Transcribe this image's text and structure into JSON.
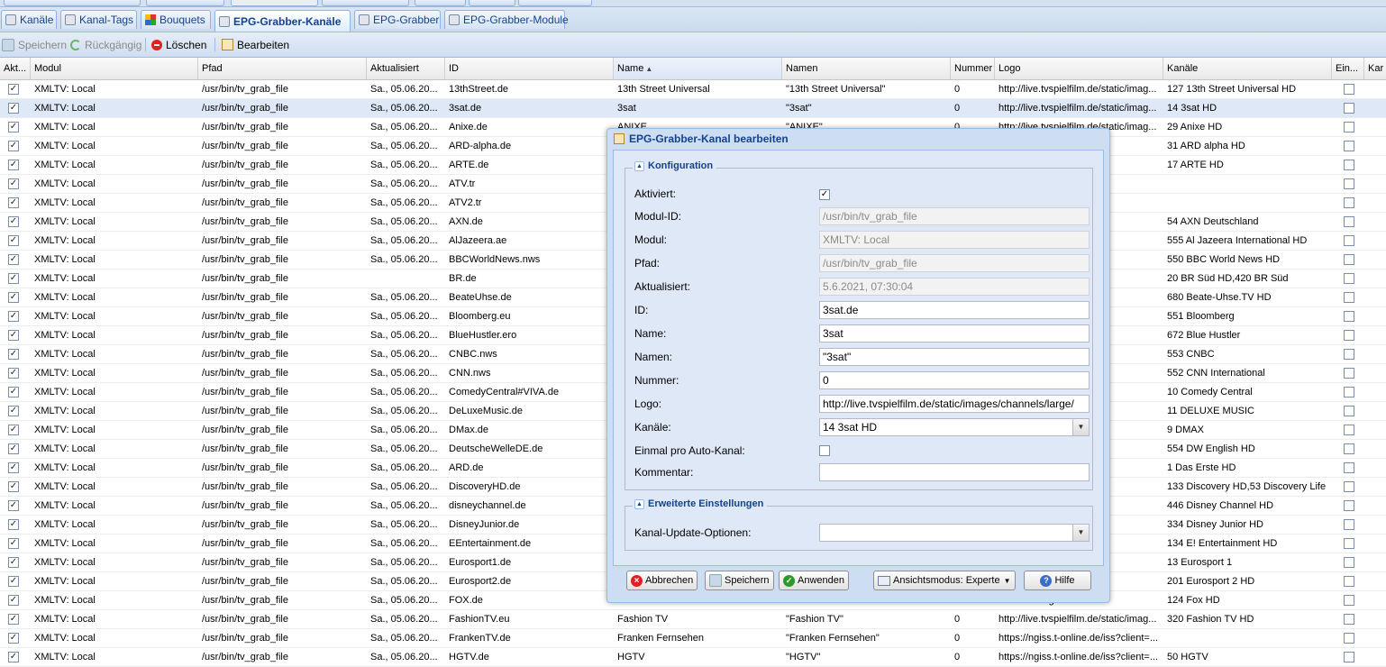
{
  "tabs": [
    {
      "label": "Kanäle",
      "icon": "channel-icon"
    },
    {
      "label": "Kanal-Tags",
      "icon": "tag-icon"
    },
    {
      "label": "Bouquets",
      "icon": "bouquet-icon"
    },
    {
      "label": "EPG-Grabber-Kanäle",
      "icon": "epg-grabber-channels-icon"
    },
    {
      "label": "EPG-Grabber",
      "icon": "epg-grabber-icon"
    },
    {
      "label": "EPG-Grabber-Module",
      "icon": "epg-grabber-modules-icon"
    }
  ],
  "toolbar": {
    "save": "Speichern",
    "undo": "Rückgängig",
    "delete": "Löschen",
    "edit": "Bearbeiten"
  },
  "columns": [
    "Akt...",
    "Modul",
    "Pfad",
    "Aktualisiert",
    "ID",
    "Name",
    "Namen",
    "Nummer",
    "Logo",
    "Kanäle",
    "Ein...",
    "Kar"
  ],
  "rows": [
    [
      "XMLTV: Local",
      "/usr/bin/tv_grab_file",
      "Sa., 05.06.20...",
      "13thStreet.de",
      "13th Street Universal",
      "\"13th Street Universal\"",
      "0",
      "http://live.tvspielfilm.de/static/imag...",
      "127 13th Street Universal HD"
    ],
    [
      "XMLTV: Local",
      "/usr/bin/tv_grab_file",
      "Sa., 05.06.20...",
      "3sat.de",
      "3sat",
      "\"3sat\"",
      "0",
      "http://live.tvspielfilm.de/static/imag...",
      "14 3sat HD"
    ],
    [
      "XMLTV: Local",
      "/usr/bin/tv_grab_file",
      "Sa., 05.06.20...",
      "Anixe.de",
      "ANIXE",
      "\"ANIXE\"",
      "0",
      "http://live.tvspielfilm.de/static/imag...",
      "29 Anixe HD"
    ],
    [
      "XMLTV: Local",
      "/usr/bin/tv_grab_file",
      "Sa., 05.06.20...",
      "ARD-alpha.de",
      "",
      "",
      "",
      "...static/imag...",
      "31 ARD alpha HD"
    ],
    [
      "XMLTV: Local",
      "/usr/bin/tv_grab_file",
      "Sa., 05.06.20...",
      "ARTE.de",
      "",
      "",
      "",
      "...static/imag...",
      "17 ARTE HD"
    ],
    [
      "XMLTV: Local",
      "/usr/bin/tv_grab_file",
      "Sa., 05.06.20...",
      "ATV.tr",
      "",
      "",
      "",
      "...static/imag...",
      ""
    ],
    [
      "XMLTV: Local",
      "/usr/bin/tv_grab_file",
      "Sa., 05.06.20...",
      "ATV2.tr",
      "",
      "",
      "",
      "...static/imag...",
      ""
    ],
    [
      "XMLTV: Local",
      "/usr/bin/tv_grab_file",
      "Sa., 05.06.20...",
      "AXN.de",
      "",
      "",
      "",
      "...static/imag...",
      "54 AXN Deutschland"
    ],
    [
      "XMLTV: Local",
      "/usr/bin/tv_grab_file",
      "Sa., 05.06.20...",
      "AlJazeera.ae",
      "",
      "",
      "",
      "...static/imag...",
      "555 Al Jazeera International HD"
    ],
    [
      "XMLTV: Local",
      "/usr/bin/tv_grab_file",
      "Sa., 05.06.20...",
      "BBCWorldNews.nws",
      "",
      "",
      "",
      "...static/imag...",
      "550 BBC World News HD"
    ],
    [
      "XMLTV: Local",
      "/usr/bin/tv_grab_file",
      "",
      "BR.de",
      "",
      "",
      "",
      "...static/imag...",
      "20 BR Süd HD,420 BR Süd"
    ],
    [
      "XMLTV: Local",
      "/usr/bin/tv_grab_file",
      "Sa., 05.06.20...",
      "BeateUhse.de",
      "",
      "",
      "",
      "...static/imag...",
      "680 Beate-Uhse.TV HD"
    ],
    [
      "XMLTV: Local",
      "/usr/bin/tv_grab_file",
      "Sa., 05.06.20...",
      "Bloomberg.eu",
      "",
      "",
      "",
      "...static/imag...",
      "551 Bloomberg"
    ],
    [
      "XMLTV: Local",
      "/usr/bin/tv_grab_file",
      "Sa., 05.06.20...",
      "BlueHustler.ero",
      "",
      "",
      "",
      "...namic.ho...",
      "672 Blue Hustler"
    ],
    [
      "XMLTV: Local",
      "/usr/bin/tv_grab_file",
      "Sa., 05.06.20...",
      "CNBC.nws",
      "",
      "",
      "",
      "...static/imag...",
      "553 CNBC"
    ],
    [
      "XMLTV: Local",
      "/usr/bin/tv_grab_file",
      "Sa., 05.06.20...",
      "CNN.nws",
      "",
      "",
      "",
      "...static/imag...",
      "552 CNN International"
    ],
    [
      "XMLTV: Local",
      "/usr/bin/tv_grab_file",
      "Sa., 05.06.20...",
      "ComedyCentral#VIVA.de",
      "",
      "",
      "",
      "...static/imag...",
      "10 Comedy Central"
    ],
    [
      "XMLTV: Local",
      "/usr/bin/tv_grab_file",
      "Sa., 05.06.20...",
      "DeLuxeMusic.de",
      "",
      "",
      "",
      "...static/imag...",
      "11 DELUXE MUSIC"
    ],
    [
      "XMLTV: Local",
      "/usr/bin/tv_grab_file",
      "Sa., 05.06.20...",
      "DMax.de",
      "",
      "",
      "",
      "...static/imag...",
      "9 DMAX"
    ],
    [
      "XMLTV: Local",
      "/usr/bin/tv_grab_file",
      "Sa., 05.06.20...",
      "DeutscheWelleDE.de",
      "",
      "",
      "",
      "...static/imag...",
      "554 DW English HD"
    ],
    [
      "XMLTV: Local",
      "/usr/bin/tv_grab_file",
      "Sa., 05.06.20...",
      "ARD.de",
      "",
      "",
      "",
      "...static/imag...",
      "1 Das Erste HD"
    ],
    [
      "XMLTV: Local",
      "/usr/bin/tv_grab_file",
      "Sa., 05.06.20...",
      "DiscoveryHD.de",
      "",
      "",
      "",
      "...static/imag...",
      "133 Discovery HD,53 Discovery Life"
    ],
    [
      "XMLTV: Local",
      "/usr/bin/tv_grab_file",
      "Sa., 05.06.20...",
      "disneychannel.de",
      "",
      "",
      "",
      "...static/imag...",
      "446 Disney Channel HD"
    ],
    [
      "XMLTV: Local",
      "/usr/bin/tv_grab_file",
      "Sa., 05.06.20...",
      "DisneyJunior.de",
      "",
      "",
      "",
      "...static/imag...",
      "334 Disney Junior HD"
    ],
    [
      "XMLTV: Local",
      "/usr/bin/tv_grab_file",
      "Sa., 05.06.20...",
      "EEntertainment.de",
      "",
      "",
      "",
      "...static/imag...",
      "134 E! Entertainment HD"
    ],
    [
      "XMLTV: Local",
      "/usr/bin/tv_grab_file",
      "Sa., 05.06.20...",
      "Eurosport1.de",
      "",
      "",
      "",
      "...static/imag...",
      "13 Eurosport 1"
    ],
    [
      "XMLTV: Local",
      "/usr/bin/tv_grab_file",
      "Sa., 05.06.20...",
      "Eurosport2.de",
      "",
      "",
      "",
      "...static/imag...",
      "201 Eurosport 2 HD"
    ],
    [
      "XMLTV: Local",
      "/usr/bin/tv_grab_file",
      "Sa., 05.06.20...",
      "FOX.de",
      "",
      "",
      "",
      "...static/imag...",
      "124 Fox HD"
    ],
    [
      "XMLTV: Local",
      "/usr/bin/tv_grab_file",
      "Sa., 05.06.20...",
      "FashionTV.eu",
      "Fashion TV",
      "\"Fashion TV\"",
      "0",
      "http://live.tvspielfilm.de/static/imag...",
      "320 Fashion TV HD"
    ],
    [
      "XMLTV: Local",
      "/usr/bin/tv_grab_file",
      "Sa., 05.06.20...",
      "FrankenTV.de",
      "Franken Fernsehen",
      "\"Franken Fernsehen\"",
      "0",
      "https://ngiss.t-online.de/iss?client=...",
      ""
    ],
    [
      "XMLTV: Local",
      "/usr/bin/tv_grab_file",
      "Sa., 05.06.20...",
      "HGTV.de",
      "HGTV",
      "\"HGTV\"",
      "0",
      "https://ngiss.t-online.de/iss?client=...",
      "50 HGTV"
    ]
  ],
  "dialog": {
    "title": "EPG-Grabber-Kanal bearbeiten",
    "section1": "Konfiguration",
    "labels": {
      "enabled": "Aktiviert:",
      "module_id": "Modul-ID:",
      "module": "Modul:",
      "path": "Pfad:",
      "updated": "Aktualisiert:",
      "id": "ID:",
      "name": "Name:",
      "names": "Namen:",
      "number": "Nummer:",
      "logo": "Logo:",
      "channels": "Kanäle:",
      "once_per_auto": "Einmal pro Auto-Kanal:",
      "comment": "Kommentar:"
    },
    "values": {
      "module_id": "/usr/bin/tv_grab_file",
      "module": "XMLTV: Local",
      "path": "/usr/bin/tv_grab_file",
      "updated": "5.6.2021, 07:30:04",
      "id": "3sat.de",
      "name": "3sat",
      "names": "\"3sat\"",
      "number": "0",
      "logo": "http://live.tvspielfilm.de/static/images/channels/large/",
      "channels": "14 3sat HD",
      "comment": ""
    },
    "section2": "Erweiterte Einstellungen",
    "update_options_label": "Kanal-Update-Optionen:",
    "update_options_value": "",
    "buttons": {
      "cancel": "Abbrechen",
      "save": "Speichern",
      "apply": "Anwenden",
      "view_mode": "Ansichtsmodus: Experte",
      "help": "Hilfe"
    }
  }
}
